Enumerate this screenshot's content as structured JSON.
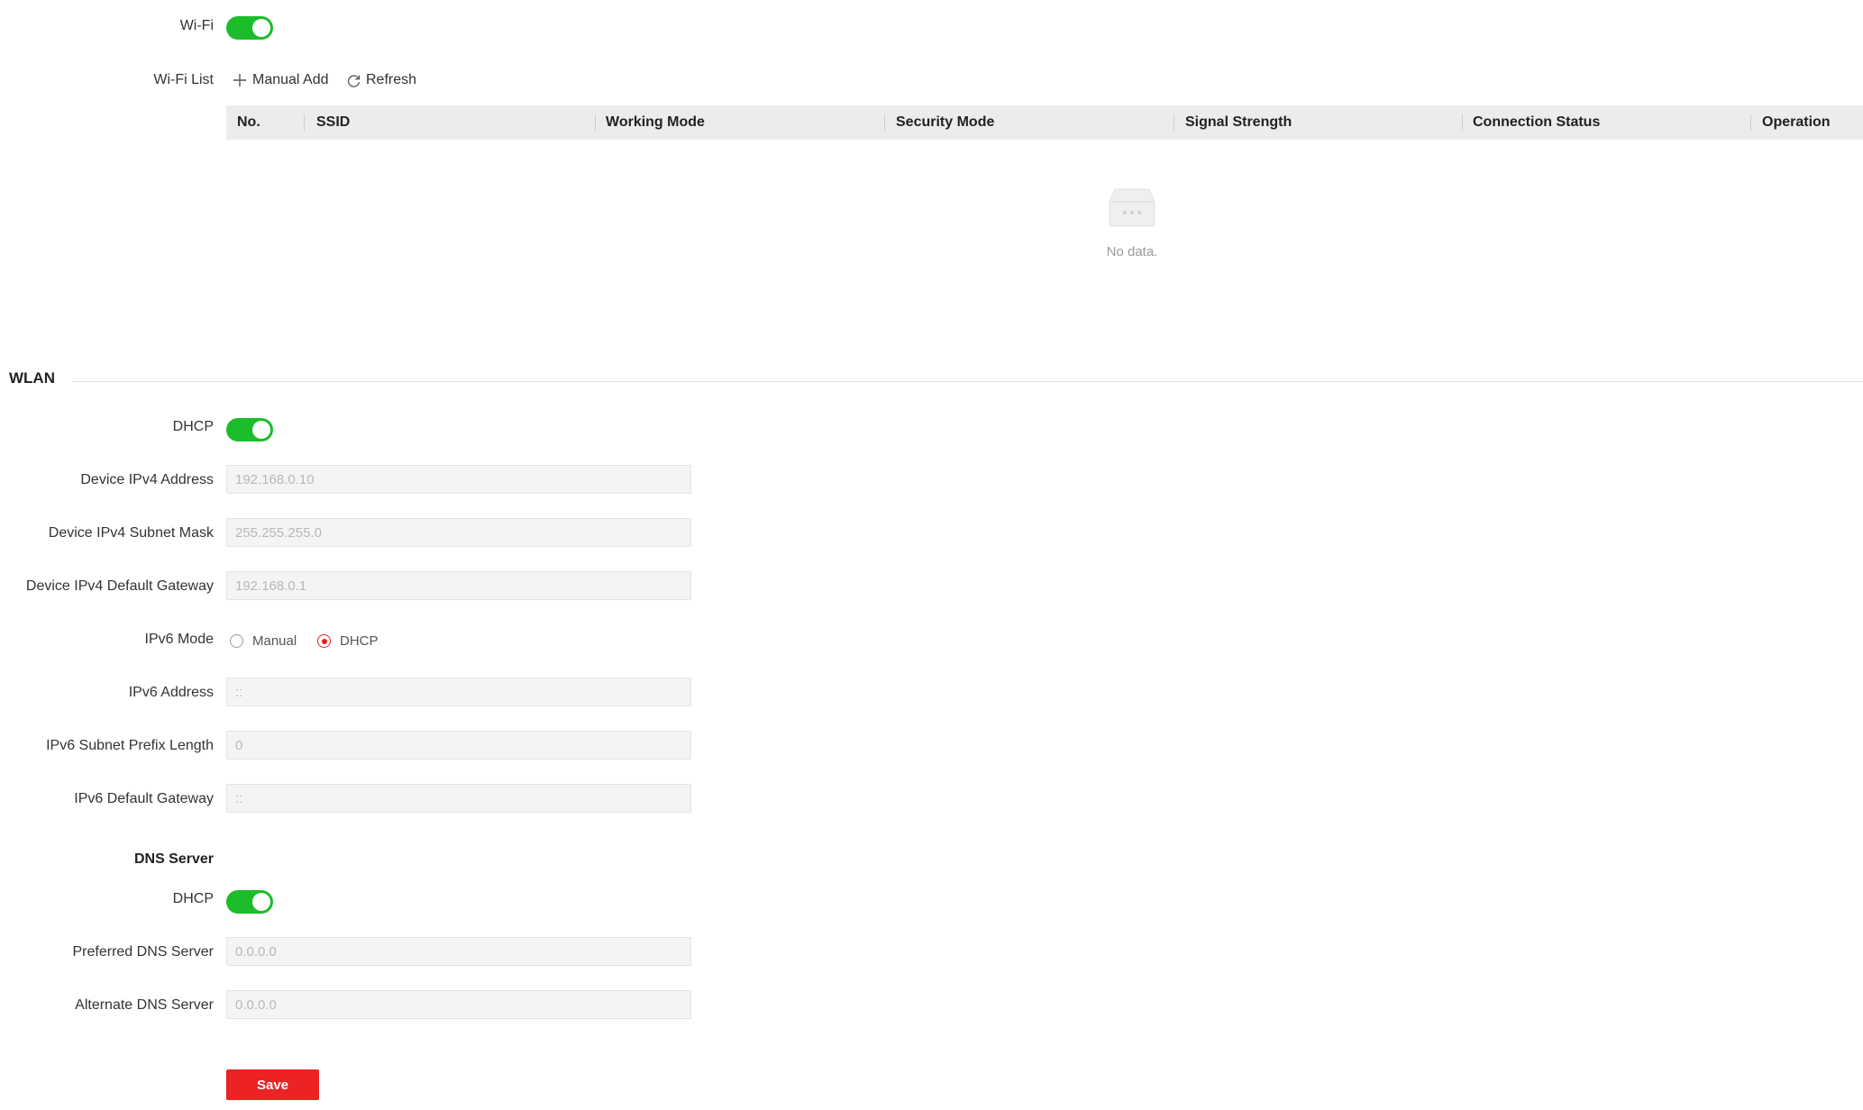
{
  "wifi": {
    "toggle_label": "Wi-Fi",
    "enabled": true,
    "list_label": "Wi-Fi List",
    "manual_add_label": "Manual Add",
    "refresh_label": "Refresh",
    "columns": [
      "No.",
      "SSID",
      "Working Mode",
      "Security Mode",
      "Signal Strength",
      "Connection Status",
      "Operation"
    ],
    "empty_text": "No data."
  },
  "wlan": {
    "section_title": "WLAN",
    "dhcp_label": "DHCP",
    "dhcp_enabled": true,
    "ipv4_address_label": "Device IPv4 Address",
    "ipv4_address_value": "192.168.0.10",
    "ipv4_mask_label": "Device IPv4 Subnet Mask",
    "ipv4_mask_value": "255.255.255.0",
    "ipv4_gateway_label": "Device IPv4 Default Gateway",
    "ipv4_gateway_value": "192.168.0.1",
    "ipv6_mode_label": "IPv6 Mode",
    "ipv6_mode_options": [
      "Manual",
      "DHCP"
    ],
    "ipv6_mode_selected": "DHCP",
    "ipv6_address_label": "IPv6 Address",
    "ipv6_address_value": "::",
    "ipv6_prefix_label": "IPv6 Subnet Prefix Length",
    "ipv6_prefix_value": "0",
    "ipv6_gateway_label": "IPv6 Default Gateway",
    "ipv6_gateway_value": "::"
  },
  "dns": {
    "section_title": "DNS Server",
    "dhcp_label": "DHCP",
    "dhcp_enabled": true,
    "preferred_label": "Preferred DNS Server",
    "preferred_value": "0.0.0.0",
    "alternate_label": "Alternate DNS Server",
    "alternate_value": "0.0.0.0"
  },
  "save_label": "Save",
  "colors": {
    "toggle_on": "#1bbd2a",
    "accent": "#ec2224",
    "header_bg": "#ececec"
  }
}
